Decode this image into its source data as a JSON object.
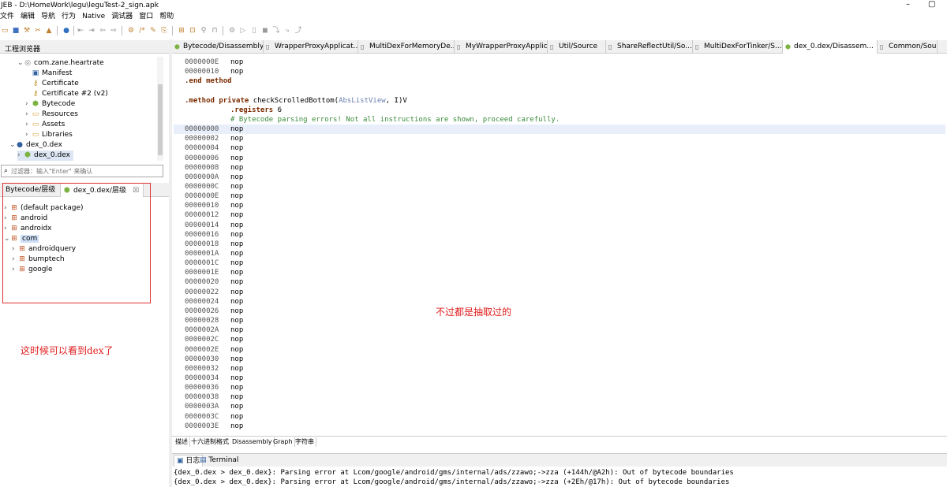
{
  "window": {
    "title": "JEB - D:\\HomeWork\\legu\\leguTest-2_sign.apk",
    "minimize": "–",
    "restore": "▢"
  },
  "menu": [
    "文件",
    "编辑",
    "导航",
    "行为",
    "Native",
    "调试器",
    "窗口",
    "帮助"
  ],
  "project_pane": {
    "tab_label": "工程浏览器",
    "tree": [
      {
        "label": "com.zane.heartrate",
        "icon": "apk-icon"
      },
      {
        "label": "Manifest",
        "icon": "manifest-icon"
      },
      {
        "label": "Certificate",
        "icon": "key-icon"
      },
      {
        "label": "Certificate #2 (v2)",
        "icon": "key-icon"
      },
      {
        "label": "Bytecode",
        "icon": "android-icon"
      },
      {
        "label": "Resources",
        "icon": "folder-icon"
      },
      {
        "label": "Assets",
        "icon": "folder-icon"
      },
      {
        "label": "Libraries",
        "icon": "folder-icon"
      },
      {
        "label": "dex_0.dex",
        "icon": "dot-icon"
      },
      {
        "label": "dex_0.dex",
        "icon": "android-icon"
      }
    ],
    "filter_placeholder": "过滤器：输入\"Enter\" 来确认"
  },
  "hierarchy_pane": {
    "tabs": [
      "Bytecode/层级",
      "dex_0.dex/层级"
    ],
    "close_glyph": "☒",
    "tree": [
      "(default package)",
      "android",
      "androidx",
      "com",
      "androidquery",
      "bumptech",
      "google"
    ]
  },
  "annotations": {
    "left": "这时候可以看到dex了",
    "right": "不过都是抽取过的"
  },
  "editor_tabs": [
    "Bytecode/Disassembly",
    "WrapperProxyApplicat...",
    "MultiDexForMemoryDe...",
    "MyWrapperProxyApplic...",
    "Util/Source",
    "ShareReflectUtil/So...",
    "MultiDexForTinker/S...",
    "dex_0.dex/Disassem...",
    "Common/Source"
  ],
  "code": {
    "pre": [
      {
        "addr": "0000000E",
        "op": "nop"
      },
      {
        "addr": "00000010",
        "op": "nop"
      }
    ],
    "end_method": ".end method",
    "method_kw": ".method private",
    "method_name": " checkScrolledBottom(",
    "method_param": "AbsListView",
    "method_rest": ", I)V",
    "registers_kw": ".registers",
    "registers_val": " 6",
    "comment": "# Bytecode parsing errors! Not all instructions are shown, proceed carefully.",
    "body": [
      "00000000",
      "00000002",
      "00000004",
      "00000006",
      "00000008",
      "0000000A",
      "0000000C",
      "0000000E",
      "00000010",
      "00000012",
      "00000014",
      "00000016",
      "00000018",
      "0000001A",
      "0000001C",
      "0000001E",
      "00000020",
      "00000022",
      "00000024",
      "00000026",
      "00000028",
      "0000002A",
      "0000002C",
      "0000002E",
      "00000030",
      "00000032",
      "00000034",
      "00000036",
      "00000038",
      "0000003A",
      "0000003C",
      "0000003E"
    ],
    "op": "nop"
  },
  "bottom_tabs": [
    "描述",
    "十六进制格式",
    "Disassembly",
    "Graph",
    "字符串"
  ],
  "console_tabs": [
    "日志",
    "Terminal"
  ],
  "console_lines": [
    "{dex_0.dex > dex_0.dex}: Parsing error at Lcom/google/android/gms/internal/ads/zzawo;->zza (+144h/@A2h): Out of bytecode boundaries",
    "{dex_0.dex > dex_0.dex}: Parsing error at Lcom/google/android/gms/internal/ads/zzawo;->zza (+2Eh/@17h): Out of bytecode boundaries"
  ]
}
